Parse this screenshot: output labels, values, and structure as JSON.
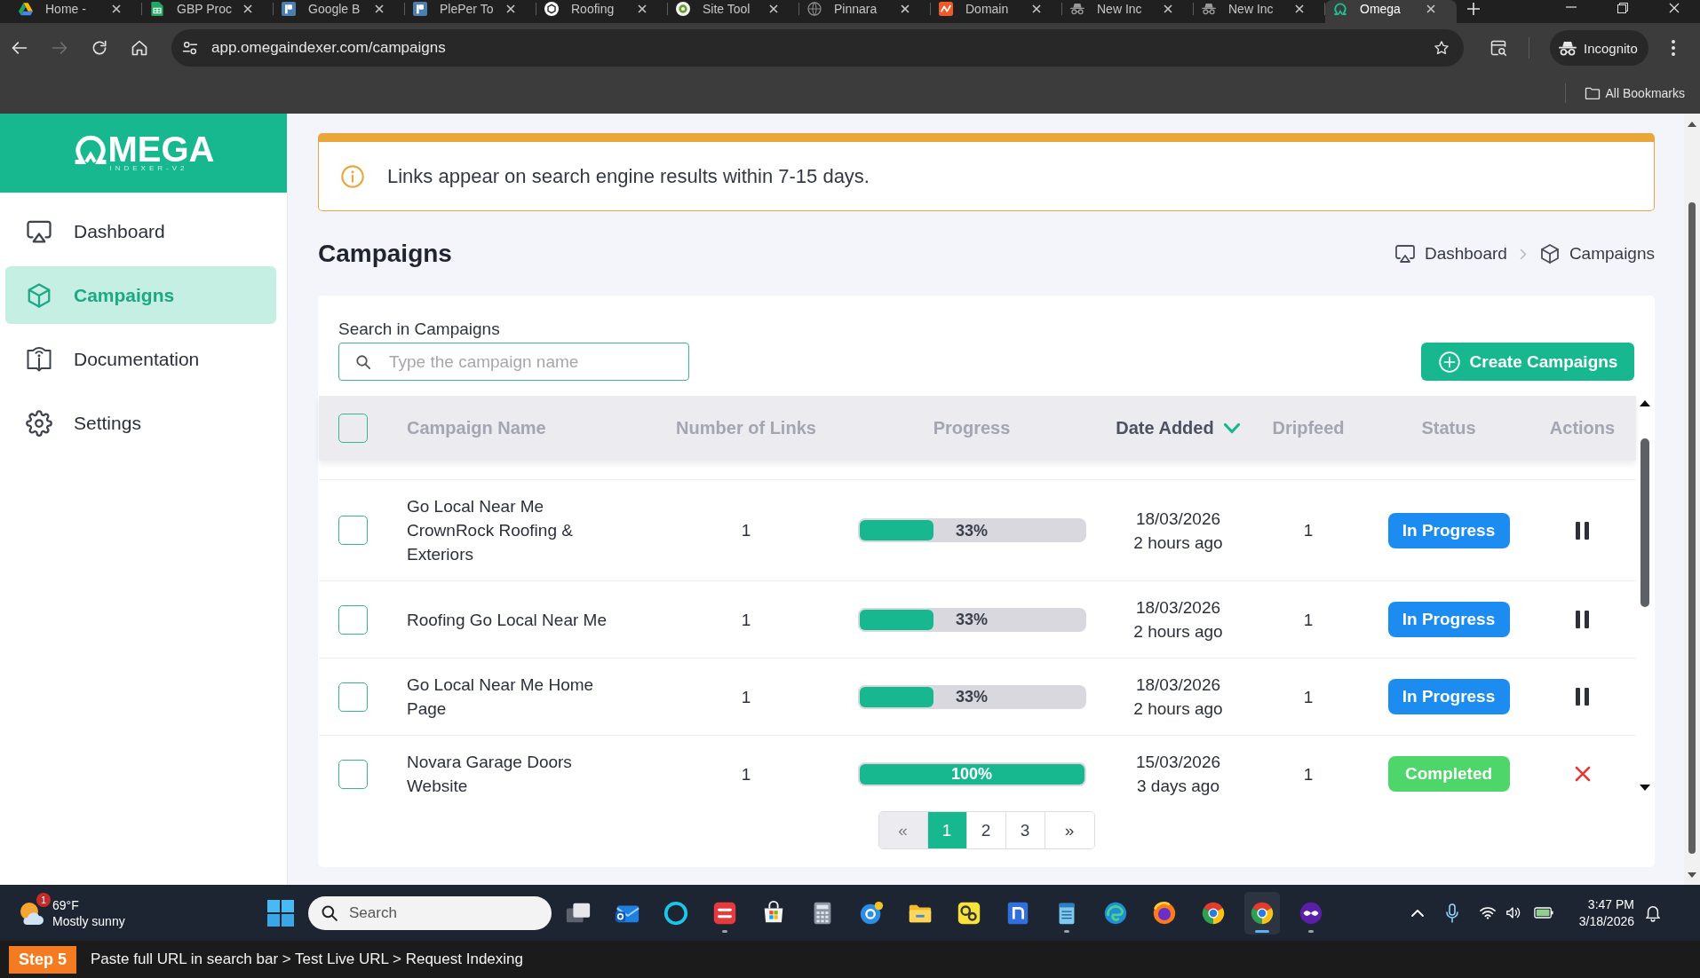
{
  "browser": {
    "tabs": [
      {
        "title": "Home -",
        "kind": "triangle",
        "selected": false
      },
      {
        "title": "GBP Proc",
        "kind": "sheet",
        "selected": false
      },
      {
        "title": "Google B",
        "kind": "tile",
        "selected": false
      },
      {
        "title": "PlePer To",
        "kind": "tile",
        "selected": false
      },
      {
        "title": "Roofing",
        "kind": "hexagon",
        "selected": false
      },
      {
        "title": "Site Tool",
        "kind": "dot",
        "selected": false
      },
      {
        "title": "Pinnara",
        "kind": "globe",
        "selected": false
      },
      {
        "title": "Domain",
        "kind": "zigzag",
        "selected": false
      },
      {
        "title": "New Inc",
        "kind": "incognito",
        "selected": false
      },
      {
        "title": "New Inc",
        "kind": "incognito",
        "selected": false
      },
      {
        "title": "Omega",
        "kind": "arch",
        "selected": true
      }
    ],
    "forward_disabled": true,
    "address": "app.omegaindexer.com/campaigns",
    "profile": "Incognito",
    "bookmarks": "All Bookmarks"
  },
  "sidebar": {
    "logo": {
      "wordmark": "MEGA",
      "tagline": "INDEXER-V2"
    },
    "items": [
      {
        "label": "Dashboard",
        "kind": "monitor",
        "selected": false
      },
      {
        "label": "Campaigns",
        "kind": "cube",
        "selected": true
      },
      {
        "label": "Documentation",
        "kind": "book",
        "selected": false
      },
      {
        "label": "Settings",
        "kind": "gear",
        "selected": false
      }
    ]
  },
  "alert": {
    "text": "Links appear on search engine results within 7-15 days."
  },
  "page": {
    "title": "Campaigns",
    "breadcrumb": [
      {
        "label": "Dashboard",
        "kind": "monitor"
      },
      {
        "label": "Campaigns",
        "kind": "cube"
      }
    ]
  },
  "search": {
    "label": "Search in Campaigns",
    "placeholder": "Type the campaign name"
  },
  "create_button": {
    "label": "Create Campaigns"
  },
  "table": {
    "select_all": {
      "checked": false
    },
    "columns": [
      {
        "label": "Campaign Name",
        "sorted": false
      },
      {
        "label": "Number of Links",
        "sorted": false
      },
      {
        "label": "Progress",
        "sorted": false
      },
      {
        "label": "Date Added",
        "sorted": true
      },
      {
        "label": "Dripfeed",
        "sorted": false
      },
      {
        "label": "Status",
        "sorted": false
      },
      {
        "label": "Actions",
        "sorted": false
      }
    ],
    "rows": [
      {
        "checked": false,
        "name": "Go Local Near Me CrownRock Roofing & Exteriors",
        "links": "1",
        "level": 0.33,
        "progress": "33%",
        "date": "18/03/2026",
        "age": "2 hours ago",
        "dripfeed": "1",
        "status": {
          "label": "In Progress",
          "color": "#1d8cf0"
        },
        "action": {
          "kind": "pause"
        }
      },
      {
        "checked": false,
        "name": "Roofing Go Local Near Me",
        "links": "1",
        "level": 0.33,
        "progress": "33%",
        "date": "18/03/2026",
        "age": "2 hours ago",
        "dripfeed": "1",
        "status": {
          "label": "In Progress",
          "color": "#1d8cf0"
        },
        "action": {
          "kind": "pause"
        }
      },
      {
        "checked": false,
        "name": "Go Local Near Me Home Page",
        "links": "1",
        "level": 0.33,
        "progress": "33%",
        "date": "18/03/2026",
        "age": "2 hours ago",
        "dripfeed": "1",
        "status": {
          "label": "In Progress",
          "color": "#1d8cf0"
        },
        "action": {
          "kind": "pause"
        }
      },
      {
        "checked": false,
        "name": "Novara Garage Doors Website",
        "links": "1",
        "level": 1,
        "progress": "100%",
        "date": "15/03/2026",
        "age": "3 days ago",
        "dripfeed": "1",
        "status": {
          "label": "Completed",
          "color": "#4fd66a"
        },
        "action": {
          "kind": "cancel"
        }
      }
    ]
  },
  "pagination": [
    {
      "label": "«",
      "selected": false,
      "disabled": true
    },
    {
      "label": "1",
      "selected": true,
      "disabled": false
    },
    {
      "label": "2",
      "selected": false,
      "disabled": false
    },
    {
      "label": "3",
      "selected": false,
      "disabled": false
    },
    {
      "label": "»",
      "selected": false,
      "disabled": false
    }
  ],
  "taskbar": {
    "weather": {
      "temperature": "69°F",
      "condition": "Mostly sunny",
      "alerts": "1"
    },
    "search": {
      "placeholder": "Search"
    },
    "apps": [
      {
        "kind": "stack",
        "running": false,
        "selected": false
      },
      {
        "kind": "mail",
        "running": false,
        "selected": false
      },
      {
        "kind": "ring",
        "running": false,
        "selected": false
      },
      {
        "kind": "wave",
        "running": true,
        "selected": false
      },
      {
        "kind": "bag",
        "running": false,
        "selected": false
      },
      {
        "kind": "calculator",
        "running": false,
        "selected": false
      },
      {
        "kind": "help",
        "running": false,
        "selected": false
      },
      {
        "kind": "folder",
        "running": false,
        "selected": false
      },
      {
        "kind": "gears",
        "running": false,
        "selected": false
      },
      {
        "kind": "archtile",
        "running": false,
        "selected": false
      },
      {
        "kind": "notepad",
        "running": true,
        "selected": false
      },
      {
        "kind": "swirl",
        "running": false,
        "selected": false
      },
      {
        "kind": "orb",
        "running": false,
        "selected": false
      },
      {
        "kind": "pinwheel",
        "running": false,
        "selected": false
      },
      {
        "kind": "pinwheel",
        "running": true,
        "selected": true
      },
      {
        "kind": "mask",
        "running": true,
        "selected": false
      }
    ],
    "clock": {
      "time": "3:47 PM",
      "date": "3/18/2026"
    }
  },
  "tutorial": {
    "step": "Step 5",
    "text": "Paste full URL in search bar > Test Live URL > Request Indexing"
  }
}
